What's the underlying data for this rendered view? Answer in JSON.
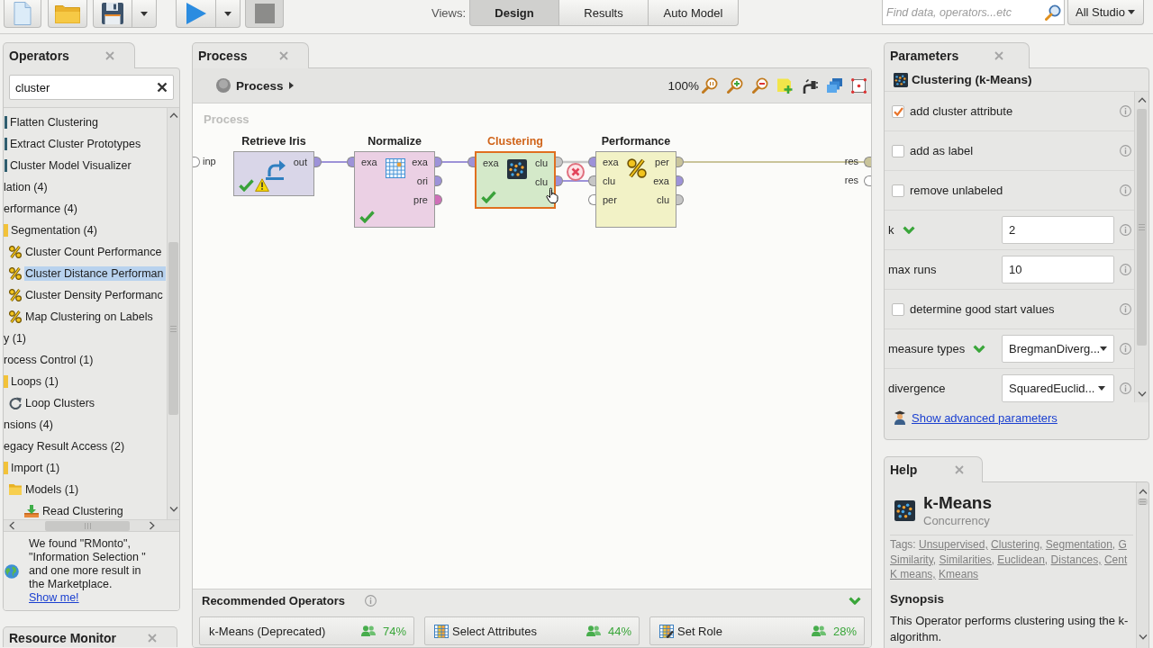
{
  "toolbar": {
    "stop": {
      "disabled": true
    },
    "views_label": "Views:",
    "views": [
      {
        "label": "Design",
        "selected": true
      },
      {
        "label": "Results",
        "selected": false
      },
      {
        "label": "Auto Model",
        "selected": false
      }
    ],
    "search": {
      "placeholder": "Find data, operators...etc"
    },
    "scope": "All Studio"
  },
  "operators_panel": {
    "title": "Operators",
    "search": {
      "value": "cluster"
    },
    "tree": {
      "continued_children": [
        {
          "label": "Flatten Clustering",
          "kind": "operator",
          "selected": false
        },
        {
          "label": "Extract Cluster Prototypes",
          "kind": "operator",
          "selected": false
        },
        {
          "label": "Cluster Model Visualizer",
          "kind": "operator",
          "selected": false
        }
      ],
      "items": [
        {
          "label": "lation (4)",
          "selected": false
        },
        {
          "label": "erformance (4)",
          "selected": false,
          "children": [
            {
              "label": "Segmentation (4)",
              "kind": "folder",
              "selected": false,
              "children": [
                {
                  "label": "Cluster Count Performance",
                  "kind": "performance",
                  "selected": false
                },
                {
                  "label": "Cluster Distance Performan",
                  "kind": "performance",
                  "selected": true
                },
                {
                  "label": "Cluster Density Performanc",
                  "kind": "performance",
                  "selected": false
                },
                {
                  "label": "Map Clustering on Labels",
                  "kind": "performance",
                  "selected": false
                }
              ]
            }
          ]
        },
        {
          "label": "y (1)",
          "selected": false
        },
        {
          "label": "rocess Control (1)",
          "selected": false,
          "children": [
            {
              "label": "Loops (1)",
              "kind": "folder",
              "selected": false,
              "children": [
                {
                  "label": "Loop Clusters",
                  "kind": "loop",
                  "selected": false
                }
              ]
            }
          ]
        },
        {
          "label": "nsions (4)",
          "selected": false
        },
        {
          "label": "egacy Result Access (2)",
          "selected": false,
          "children": [
            {
              "label": "Import (1)",
              "kind": "folder",
              "selected": false,
              "children": [
                {
                  "label": "Models (1)",
                  "kind": "folder",
                  "selected": false,
                  "children": [
                    {
                      "label": "Read Clustering",
                      "kind": "read",
                      "selected": false
                    }
                  ]
                }
              ]
            }
          ]
        }
      ]
    },
    "marketplace_note": {
      "text": "We found \"RMonto\", \"Information Selection \" and one more result in the Marketplace.",
      "link": "Show me!"
    },
    "second_tab": {
      "title": "Resource Monitor"
    }
  },
  "process_panel": {
    "title": "Process",
    "breadcrumb": "Process",
    "zoom": "100%",
    "canvas_label": "Process",
    "input_ports": [
      {
        "label": "inp",
        "color": "#ffffff"
      }
    ],
    "result_ports": [
      {
        "label": "res",
        "color": "#c9c49a"
      },
      {
        "label": "res",
        "color": "#ffffff"
      }
    ],
    "operators": [
      {
        "name": "Retrieve Iris",
        "kind": "retrieve",
        "color": "#d9d6e8",
        "selected": false,
        "ok": true,
        "warning": true,
        "outputs": [
          {
            "label": "out",
            "color": "#9d92d8"
          }
        ]
      },
      {
        "name": "Normalize",
        "kind": "normalize",
        "color": "#ebd0e4",
        "selected": false,
        "ok": true,
        "warning": false,
        "inputs": [
          {
            "label": "exa",
            "color": "#9d92d8"
          }
        ],
        "outputs": [
          {
            "label": "exa",
            "color": "#9d92d8"
          },
          {
            "label": "ori",
            "color": "#9d92d8"
          },
          {
            "label": "pre",
            "color": "#cf6fb8"
          }
        ]
      },
      {
        "name": "Clustering",
        "kind": "clustering",
        "color": "#d4e9c9",
        "selected": true,
        "ok": true,
        "warning": false,
        "inputs": [
          {
            "label": "exa",
            "color": "#9d92d8"
          }
        ],
        "outputs": [
          {
            "label": "clu",
            "color": "#c6c6c6"
          },
          {
            "label": "clu",
            "color": "#9d92d8"
          }
        ]
      },
      {
        "name": "Performance",
        "kind": "performance",
        "color": "#f2f2c6",
        "selected": false,
        "ok": false,
        "warning": false,
        "inputs": [
          {
            "label": "exa",
            "color": "#9d92d8"
          },
          {
            "label": "clu",
            "color": "#c6c6c6"
          },
          {
            "label": "per",
            "color": "#ffffff"
          }
        ],
        "outputs": [
          {
            "label": "per",
            "color": "#c9c49a"
          },
          {
            "label": "exa",
            "color": "#9d92d8"
          },
          {
            "label": "clu",
            "color": "#c6c6c6"
          }
        ]
      }
    ],
    "connections": [
      {
        "hovered": false
      },
      {
        "hovered": false
      },
      {
        "hovered": true
      },
      {
        "hovered": false
      },
      {
        "hovered": false
      }
    ]
  },
  "recommended": {
    "title": "Recommended Operators",
    "expanded": true,
    "items": [
      {
        "label": "k-Means (Deprecated)",
        "kind": "plain",
        "share": "74%"
      },
      {
        "label": "Select Attributes",
        "kind": "attributes",
        "share": "44%"
      },
      {
        "label": "Set Role",
        "kind": "role",
        "share": "28%"
      }
    ]
  },
  "parameters_panel": {
    "title": "Parameters",
    "operator": "Clustering (k-Means)",
    "rows": [
      {
        "kind": "checkbox",
        "label": "add cluster attribute",
        "checked": true,
        "important": false
      },
      {
        "kind": "checkbox",
        "label": "add as label",
        "checked": false,
        "important": false
      },
      {
        "kind": "checkbox",
        "label": "remove unlabeled",
        "checked": false,
        "important": false
      },
      {
        "kind": "number",
        "label": "k",
        "value": "2",
        "important": true
      },
      {
        "kind": "number",
        "label": "max runs",
        "value": "10",
        "important": false
      },
      {
        "kind": "checkbox",
        "label": "determine good start values",
        "checked": false,
        "important": false
      },
      {
        "kind": "dropdown",
        "label": "measure types",
        "value": "BregmanDiverg...",
        "important": true
      },
      {
        "kind": "dropdown",
        "label": "divergence",
        "value": "SquaredEuclid...",
        "important": false
      }
    ],
    "advanced_link": "Show advanced parameters"
  },
  "help_panel": {
    "title": "Help",
    "operator": "k-Means",
    "subtitle": "Concurrency",
    "tags_label": "Tags:",
    "tag_lines": [
      [
        "Unsupervised,",
        "Clustering,",
        "Segmentation,",
        "G"
      ],
      [
        "Similarity,",
        "Similarities,",
        "Euclidean,",
        "Distances,",
        "Cent"
      ],
      [
        "K means,",
        "Kmeans"
      ]
    ],
    "synopsis_title": "Synopsis",
    "synopsis": "This Operator performs clustering using the k- algorithm."
  }
}
